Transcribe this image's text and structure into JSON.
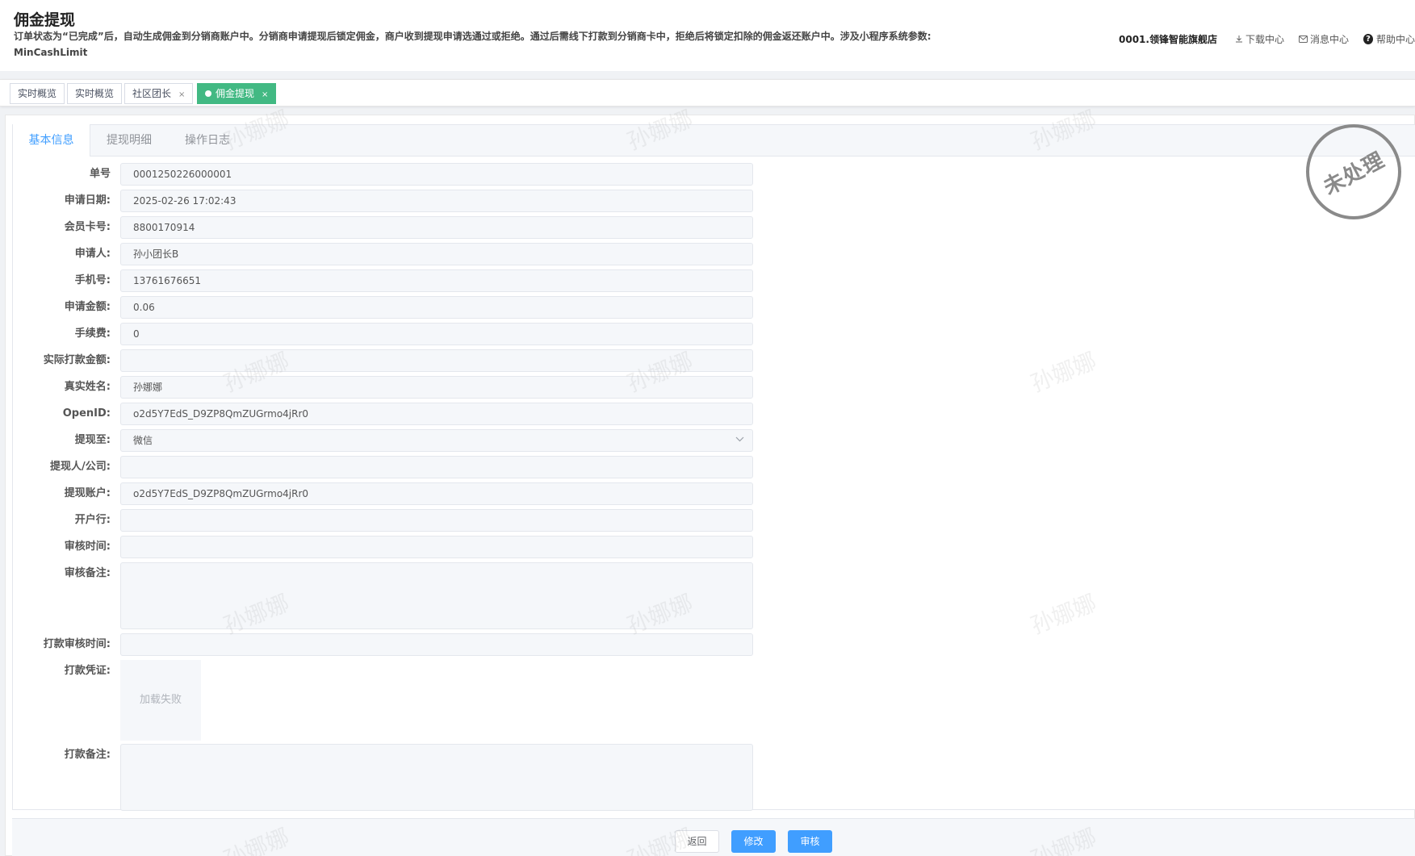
{
  "header": {
    "title": "佣金提现",
    "description": "订单状态为“已完成”后，自动生成佣金到分销商账户中。分销商申请提现后锁定佣金，商户收到提现申请选通过或拒绝。通过后需线下打款到分销商卡中，拒绝后将锁定扣除的佣金返还账户中。涉及小程序系统参数: MinCashLimit",
    "store_name": "0001.领锋智能旗舰店",
    "download_center": "下载中心",
    "message_center": "消息中心",
    "help_center": "帮助中心"
  },
  "page_tabs": [
    {
      "label": "实时概览",
      "closable": false,
      "active": false
    },
    {
      "label": "实时概览",
      "closable": false,
      "active": false
    },
    {
      "label": "社区团长",
      "closable": true,
      "active": false
    },
    {
      "label": "佣金提现",
      "closable": true,
      "active": true
    }
  ],
  "close_glyph": "×",
  "detail_tabs": [
    {
      "label": "基本信息",
      "active": true
    },
    {
      "label": "提现明细",
      "active": false
    },
    {
      "label": "操作日志",
      "active": false
    }
  ],
  "form": {
    "order_no": {
      "label": "单号",
      "value": "0001250226000001"
    },
    "apply_date": {
      "label": "申请日期:",
      "value": "2025-02-26 17:02:43"
    },
    "member_card": {
      "label": "会员卡号:",
      "value": "8800170914"
    },
    "applicant": {
      "label": "申请人:",
      "value": "孙小团长B"
    },
    "phone": {
      "label": "手机号:",
      "value": "13761676651"
    },
    "apply_amount": {
      "label": "申请金额:",
      "value": "0.06"
    },
    "fee": {
      "label": "手续费:",
      "value": "0"
    },
    "actual_amount": {
      "label": "实际打款金额:",
      "value": ""
    },
    "real_name": {
      "label": "真实姓名:",
      "value": "孙娜娜"
    },
    "openid": {
      "label": "OpenID:",
      "value": "o2d5Y7EdS_D9ZP8QmZUGrmo4jRr0"
    },
    "withdraw_to": {
      "label": "提现至:",
      "value": "微信"
    },
    "withdraw_person": {
      "label": "提现人/公司:",
      "value": ""
    },
    "withdraw_account": {
      "label": "提现账户:",
      "value": "o2d5Y7EdS_D9ZP8QmZUGrmo4jRr0"
    },
    "bank": {
      "label": "开户行:",
      "value": ""
    },
    "audit_time": {
      "label": "审核时间:",
      "value": ""
    },
    "audit_remark": {
      "label": "审核备注:",
      "value": ""
    },
    "pay_audit_time": {
      "label": "打款审核时间:",
      "value": ""
    },
    "pay_voucher": {
      "label": "打款凭证:",
      "placeholder_text": "加载失败"
    },
    "pay_remark": {
      "label": "打款备注:",
      "value": ""
    }
  },
  "status_stamp": "未处理",
  "footer": {
    "back_label": "返回",
    "edit_label": "修改",
    "audit_label": "审核"
  },
  "watermark_text": "孙娜娜",
  "colors": {
    "accent": "#409eff",
    "active_tab": "#42b983",
    "stamp": "#8a8a8a"
  }
}
